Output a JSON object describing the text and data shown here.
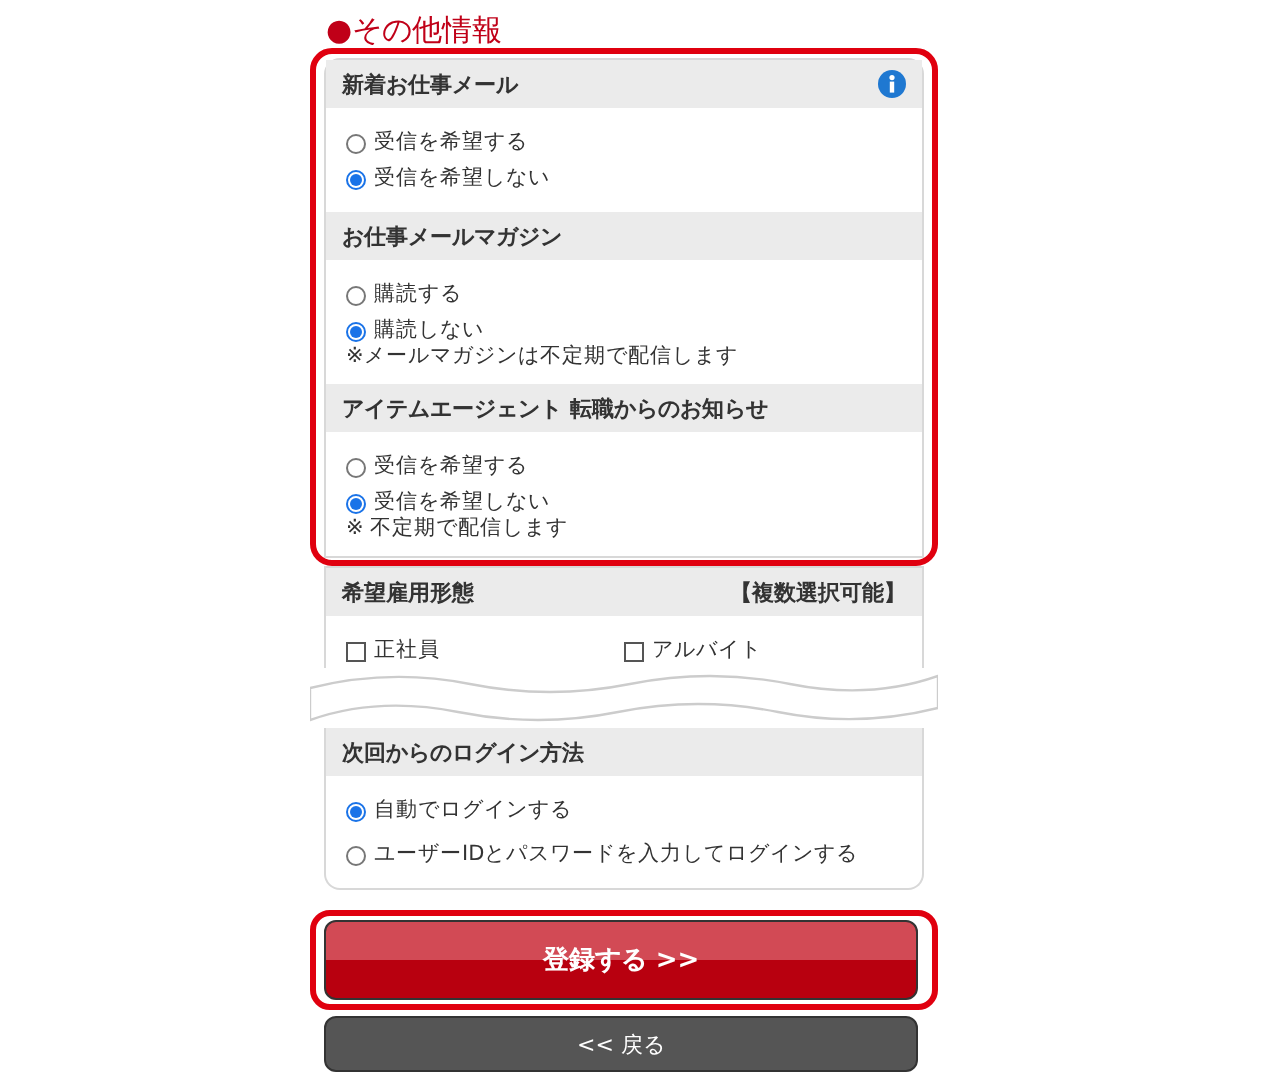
{
  "title": "●その他情報",
  "highlighted_sections": [
    {
      "heading": "新着お仕事メール",
      "info": true,
      "options": [
        {
          "label": "受信を希望する",
          "selected": false
        },
        {
          "label": "受信を希望しない",
          "selected": true
        }
      ]
    },
    {
      "heading": "お仕事メールマガジン",
      "info": false,
      "options": [
        {
          "label": "購読する",
          "selected": false
        },
        {
          "label": "購読しない",
          "selected": true
        }
      ],
      "note": "※メールマガジンは不定期で配信します"
    },
    {
      "heading": "アイテムエージェント 転職からのお知らせ",
      "info": false,
      "options": [
        {
          "label": "受信を希望する",
          "selected": false
        },
        {
          "label": "受信を希望しない",
          "selected": true
        }
      ],
      "note": "※ 不定期で配信します"
    }
  ],
  "employment": {
    "heading": "希望雇用形態",
    "hint": "【複数選択可能】",
    "options": [
      {
        "label": "正社員",
        "checked": false
      },
      {
        "label": "アルバイト",
        "checked": false
      }
    ]
  },
  "login": {
    "heading": "次回からのログイン方法",
    "options": [
      {
        "label": "自動でログインする",
        "selected": true
      },
      {
        "label": "ユーザーIDとパスワードを入力してログインする",
        "selected": false
      }
    ]
  },
  "submit_button": "登録する >>",
  "back_button": "<< 戻る"
}
